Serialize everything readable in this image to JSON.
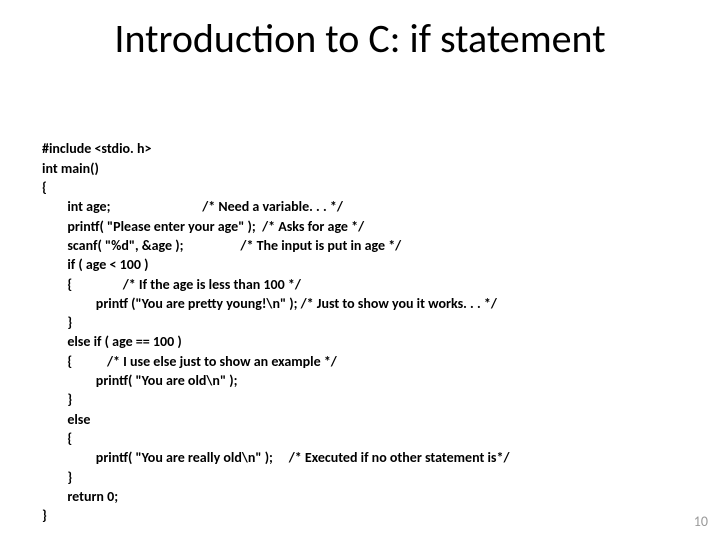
{
  "title": "Introduction to C: if statement",
  "code": {
    "l0": "#include <stdio. h>",
    "l1": "int main()",
    "l2": "{",
    "l3": "        int age;                             /* Need a variable. . . */",
    "l4": "        printf( \"Please enter your age\" );  /* Asks for age */",
    "l5": "        scanf( \"%d\", &age );                  /* The input is put in age */",
    "l6": "        if ( age < 100 )",
    "l7": "        {                /* If the age is less than 100 */",
    "l8": "                 printf (\"You are pretty young!\\n\" ); /* Just to show you it works. . . */",
    "l9": "        }",
    "l10": "        else if ( age == 100 )",
    "l11": "        {           /* I use else just to show an example */",
    "l12": "                 printf( \"You are old\\n\" );",
    "l13": "        }",
    "l14": "        else",
    "l15": "        {",
    "l16": "                 printf( \"You are really old\\n\" );     /* Executed if no other statement is*/",
    "l17": "        }",
    "l18": "        return 0;",
    "l19": "}"
  },
  "page_number": "10"
}
